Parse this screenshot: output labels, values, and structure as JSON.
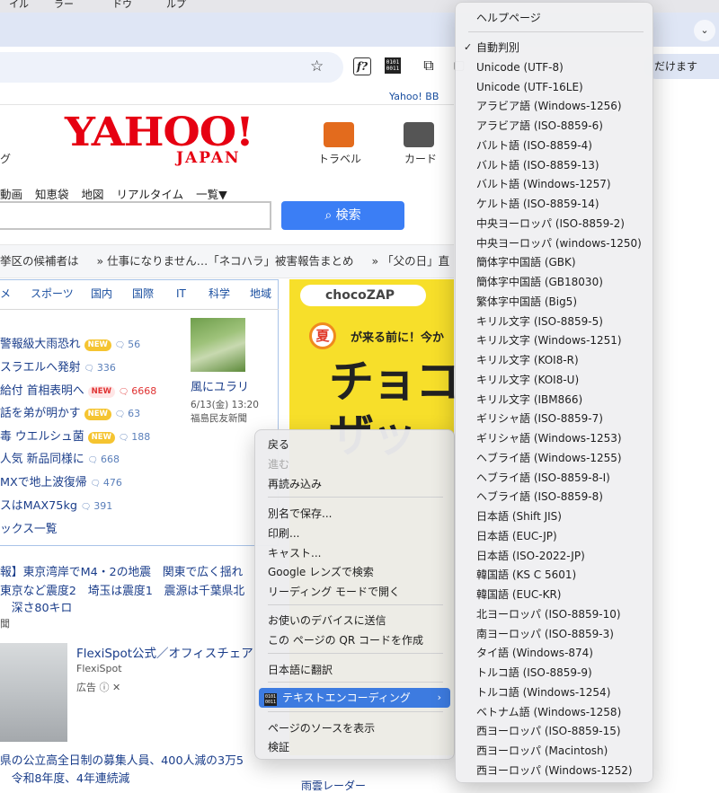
{
  "menubar": {
    "items": [
      "イル",
      "ラー",
      "ドウ",
      "ルプ"
    ]
  },
  "chrome": {
    "tab_chevron": "⌄",
    "account_pill": "だけます",
    "star_icon": "☆",
    "ext_f": "f?",
    "ext_bin": "0101\n0011",
    "ext_puzzle": "⧉",
    "ext_pip": "▢"
  },
  "page": {
    "yahoo_bb": "Yahoo! BB",
    "left_fragment": "グ",
    "logo_main": "YAHOO!",
    "logo_sub": "JAPAN",
    "services": [
      {
        "label": "トラベル",
        "color": "#e36b1d"
      },
      {
        "label": "カード",
        "color": "#555555"
      }
    ],
    "subnav": [
      "動画",
      "知恵袋",
      "地図",
      "リアルタイム",
      "一覧▼"
    ],
    "search_button": "検索",
    "ticker": [
      "挙区の候補者は",
      "» 仕事になりません…「ネコハラ」被害報告まとめ",
      "» 「父の日」直"
    ],
    "news_tabs": [
      "メ",
      "スポーツ",
      "国内",
      "国際",
      "IT",
      "科学",
      "地域"
    ],
    "news_items": [
      {
        "text": "警報級大雨恐れ",
        "badge": "NEW",
        "count": "56",
        "hot": false
      },
      {
        "text": "スラエルへ発射",
        "badge": "",
        "count": "336",
        "hot": false
      },
      {
        "text": "給付 首相表明へ",
        "badge": "NEW",
        "count": "6668",
        "hot": true
      },
      {
        "text": "話を弟が明かす",
        "badge": "NEW",
        "count": "63",
        "hot": false
      },
      {
        "text": "毒 ウエルシュ菌",
        "badge": "NEW",
        "count": "188",
        "hot": false
      },
      {
        "text": "人気 新品同様に",
        "badge": "",
        "count": "668",
        "hot": false
      },
      {
        "text": "MXで地上波復帰",
        "badge": "",
        "count": "476",
        "hot": false
      },
      {
        "text": "スはMAX75kg",
        "badge": "",
        "count": "391",
        "hot": false
      },
      {
        "text": "ックス一覧",
        "badge": "",
        "count": "",
        "hot": false
      }
    ],
    "feature": {
      "title": "風にユラリ",
      "date": "6/13(金) 13:20",
      "source": "福島民友新聞"
    },
    "ad": {
      "brand": "chocoZAP",
      "sun": "夏",
      "tagline": "が来る前に！今か",
      "big": "チョコ\nザッ"
    },
    "lower_news": [
      "報】東京湾岸でM4・2の地震　関東で広く揺れ",
      "東京など震度2　埼玉は震度1　震源は千葉県北",
      "　深さ80キロ",
      "聞"
    ],
    "flexispot": {
      "title": "FlexiSpot公式／オフィスチェア",
      "sub": "FlexiSpot",
      "ad_label": "広告 ⓘ ✕"
    },
    "bottom_news": [
      "県の公立高全日制の募集人員、400人減の3万5",
      "　令和8年度、4年連続減"
    ],
    "amedas": "雨雲レーダー"
  },
  "context_menu": {
    "items": [
      {
        "label": "戻る",
        "disabled": false
      },
      {
        "label": "進む",
        "disabled": true
      },
      {
        "label": "再読み込み",
        "disabled": false
      },
      {
        "label": "別名で保存...",
        "disabled": false
      },
      {
        "label": "印刷...",
        "disabled": false
      },
      {
        "label": "キャスト...",
        "disabled": false
      },
      {
        "label": "Google レンズで検索",
        "disabled": false
      },
      {
        "label": "リーディング モードで開く",
        "disabled": false
      },
      {
        "label": "お使いのデバイスに送信",
        "disabled": false
      },
      {
        "label": "この ページの QR コードを作成",
        "disabled": false
      },
      {
        "label": "日本語に翻訳",
        "disabled": false
      },
      {
        "label": "テキストエンコーディング",
        "disabled": false,
        "active": true,
        "icon": "0101\n0011",
        "arrow": "›"
      },
      {
        "label": "ページのソースを表示",
        "disabled": false
      },
      {
        "label": "検証",
        "disabled": false
      }
    ]
  },
  "encoding_menu": {
    "help": "ヘルプページ",
    "checkmark": "✓",
    "selected_index": 0,
    "items": [
      "自動判別",
      "Unicode (UTF-8)",
      "Unicode (UTF-16LE)",
      "アラビア語 (Windows-1256)",
      "アラビア語 (ISO-8859-6)",
      "バルト語 (ISO-8859-4)",
      "バルト語 (ISO-8859-13)",
      "バルト語 (Windows-1257)",
      "ケルト語 (ISO-8859-14)",
      "中央ヨーロッパ (ISO-8859-2)",
      "中央ヨーロッパ (windows-1250)",
      "簡体字中国語 (GBK)",
      "簡体字中国語 (GB18030)",
      "繁体字中国語 (Big5)",
      "キリル文字 (ISO-8859-5)",
      "キリル文字 (Windows-1251)",
      "キリル文字 (KOI8-R)",
      "キリル文字 (KOI8-U)",
      "キリル文字 (IBM866)",
      "ギリシャ語 (ISO-8859-7)",
      "ギリシャ語 (Windows-1253)",
      "ヘブライ語 (Windows-1255)",
      "ヘブライ語 (ISO-8859-8-I)",
      "ヘブライ語 (ISO-8859-8)",
      "日本語 (Shift JIS)",
      "日本語 (EUC-JP)",
      "日本語 (ISO-2022-JP)",
      "韓国語 (KS C 5601)",
      "韓国語 (EUC-KR)",
      "北ヨーロッパ (ISO-8859-10)",
      "南ヨーロッパ (ISO-8859-3)",
      "タイ語 (Windows-874)",
      "トルコ語 (ISO-8859-9)",
      "トルコ語 (Windows-1254)",
      "ベトナム語 (Windows-1258)",
      "西ヨーロッパ (ISO-8859-15)",
      "西ヨーロッパ (Macintosh)",
      "西ヨーロッパ (Windows-1252)"
    ]
  }
}
